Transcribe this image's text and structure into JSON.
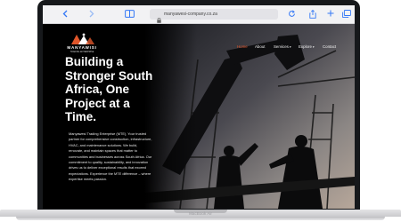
{
  "browser": {
    "url": "manyawesi-company.co.za"
  },
  "site": {
    "logo_text": "MANYAWISI",
    "logo_sub": "TRADING ENTERPRISE",
    "nav": [
      {
        "label": "Home",
        "active": true
      },
      {
        "label": "About"
      },
      {
        "label": "Services",
        "dropdown": true
      },
      {
        "label": "Explore",
        "dropdown": true
      },
      {
        "label": "Contact"
      }
    ],
    "headline": "Building a Stronger South Africa, One Project at a Time.",
    "body": "Manyawesi Trading Enterprise (MTE), Your trusted partner for comprehensive construction, infrastructure, HVAC, and maintenance solutions. We build, renovate, and maintain spaces that matter to communities and businesses across South Africa. Our commitment to quality, sustainability, and innovation drives us to deliver exceptional results that exceed expectations. Experience the MTE difference – where expertise meets passion."
  },
  "device": {
    "model": "MacBook Air"
  },
  "colors": {
    "accent": "#e0562a",
    "page_bg": "#000000"
  }
}
